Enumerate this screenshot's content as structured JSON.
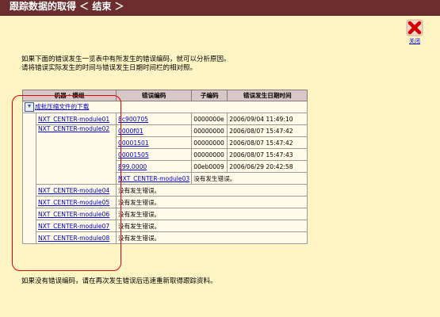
{
  "title": "跟踪数据的取得 ＜ 结束 ＞",
  "close": {
    "label": "关闭",
    "icon": "close-x-icon"
  },
  "intro": {
    "line1": "如果下面的错误发生一览表中有所发生的错误编码，就可以分析原因。",
    "line2": "请将错误实际发生的时间与错误发生日期时间栏的相对照。"
  },
  "table": {
    "headers": {
      "module": "机器・模组",
      "error_code": "错误编码",
      "sub_code": "子编码",
      "datetime": "错误发生日期时间"
    },
    "download_label": "成批压缩文件的下载",
    "no_error_text": "没有发生错误。",
    "module2_errors": [
      {
        "code": "8c900705",
        "sub": "0000000e",
        "time": "2006/09/04 11:49:10"
      },
      {
        "code": "0000f01",
        "sub": "00000000",
        "time": "2006/08/07 15:47:42"
      },
      {
        "code": "00001501",
        "sub": "00000000",
        "time": "2006/08/07 15:47:42"
      },
      {
        "code": "00001505",
        "sub": "00000000",
        "time": "2006/08/07 15:47:43"
      },
      {
        "code": "899.0000",
        "sub": "00eb0009",
        "time": "2006/06/29 20:42:58"
      }
    ],
    "modules": {
      "m1": "NXT_CENTER-module01",
      "m2": "NXT_CENTER-module02",
      "m3": "NXT_CENTER-module03",
      "m4": "NXT_CENTER-module04",
      "m5": "NXT_CENTER-module05",
      "m6": "NXT_CENTER-module06",
      "m7": "NXT_CENTER-module07",
      "m8": "NXT_CENTER-module08"
    }
  },
  "footer": "如果没有错误编码，请在再次发生错误后迅速重新取得跟踪资料。",
  "colors": {
    "titlebar": "#6b2d2d",
    "background": "#fff5c4",
    "highlight": "#e00000"
  }
}
